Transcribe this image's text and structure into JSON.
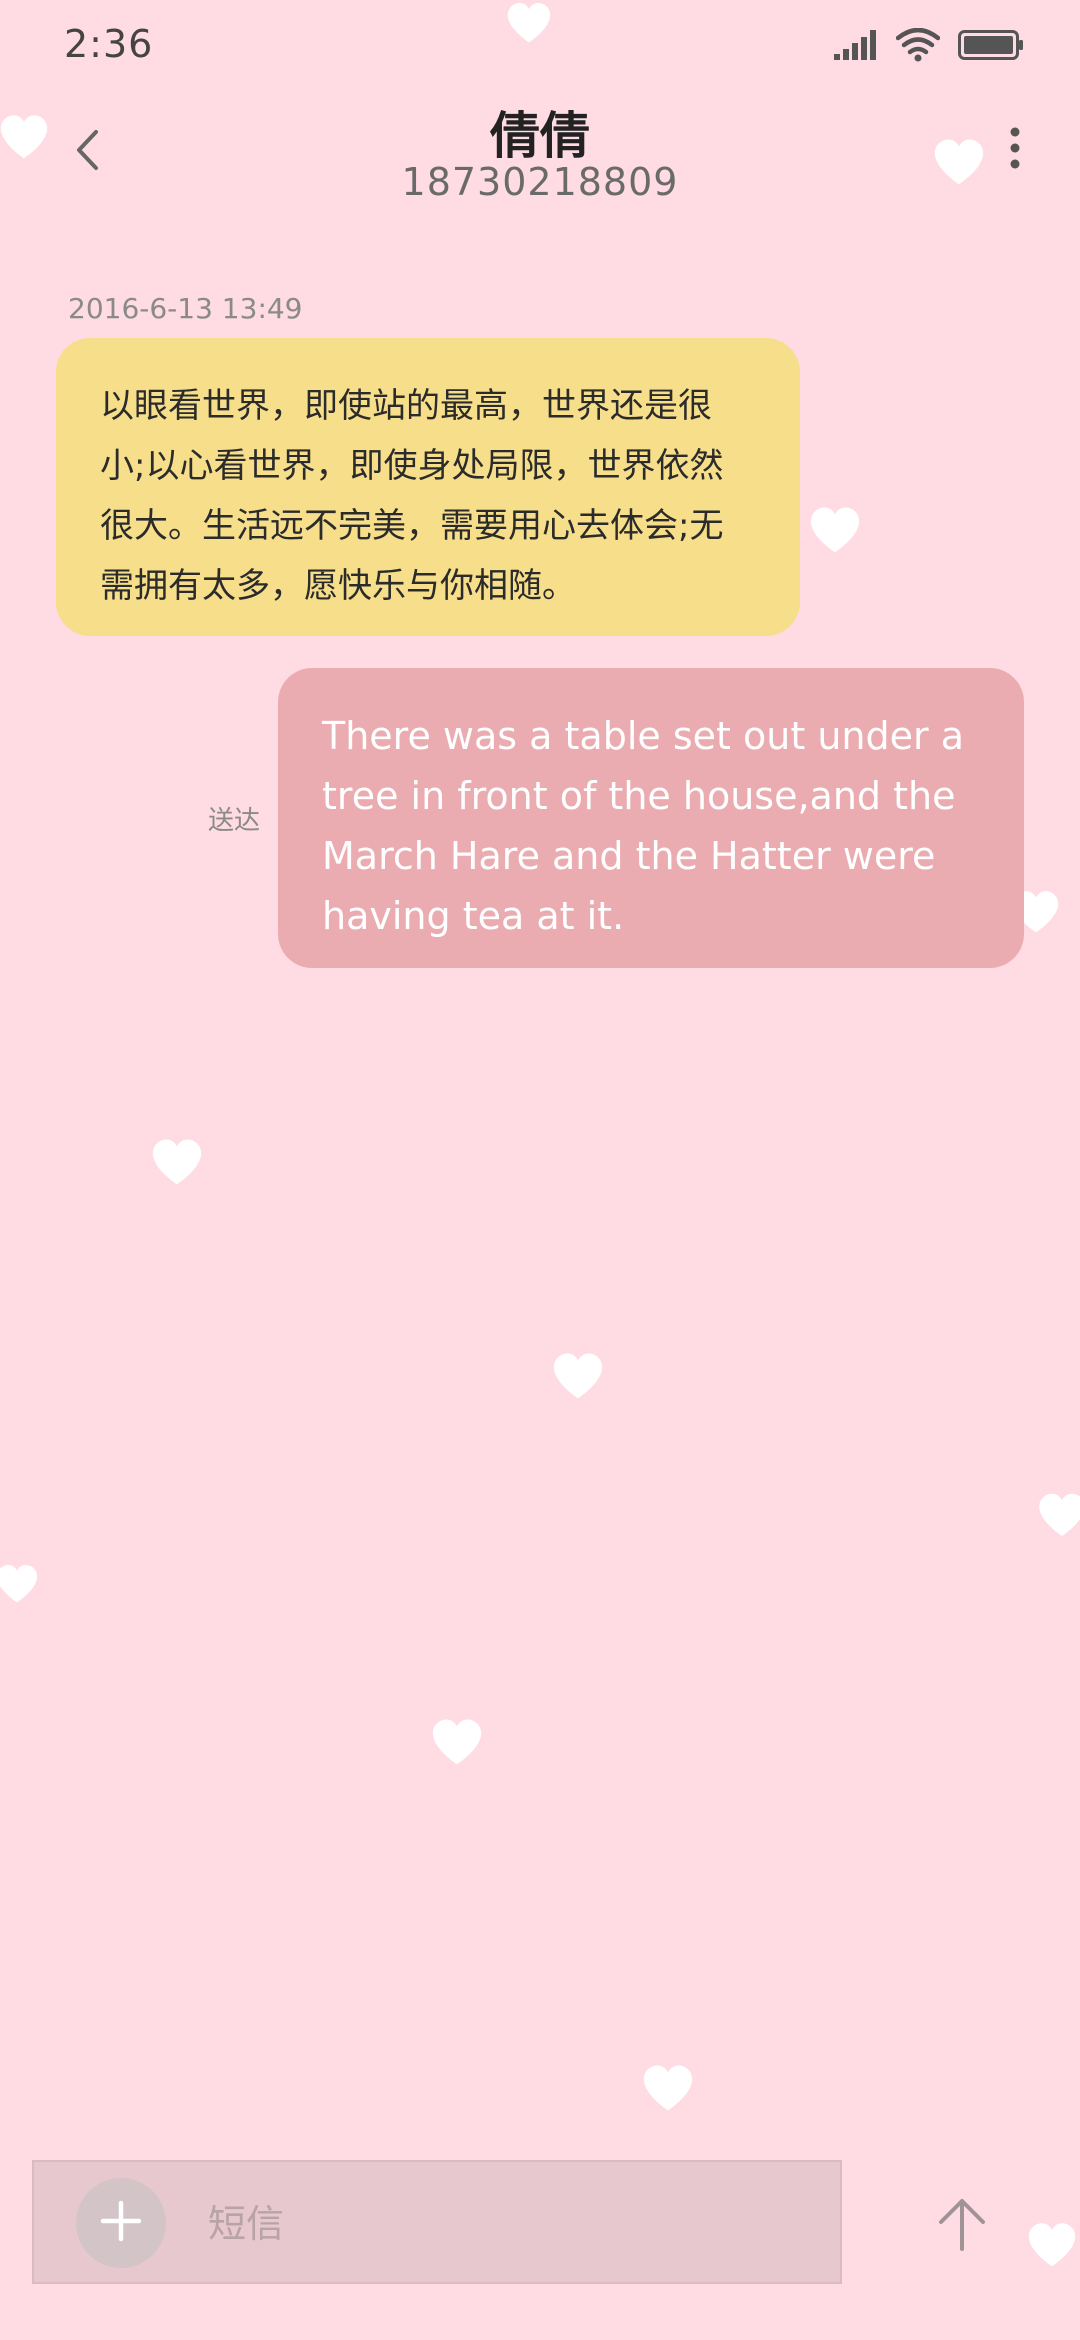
{
  "status_bar": {
    "time": "2:36"
  },
  "header": {
    "contact_name": "倩倩",
    "contact_number": "18730218809"
  },
  "messages": [
    {
      "direction": "incoming",
      "timestamp": "2016-6-13 13:49",
      "text": "以眼看世界，即使站的最高，世界还是很小;以心看世界，即使身处局限，世界依然很大。生活远不完美，需要用心去体会;无需拥有太多，愿快乐与你相随。"
    },
    {
      "direction": "outgoing",
      "status": "送达",
      "text": "There was a table set out under a tree in front of the house,and the March Hare and the Hatter were having tea at it."
    }
  ],
  "composer": {
    "placeholder": "短信"
  },
  "colors": {
    "background": "#ffdbe3",
    "incoming_bubble": "#f6de8a",
    "outgoing_bubble": "#eaacb0"
  },
  "icons": {
    "back": "chevron-left-icon",
    "more": "more-vertical-icon",
    "add": "plus-icon",
    "send": "arrow-up-icon",
    "signal": "signal-icon",
    "wifi": "wifi-icon",
    "battery": "battery-icon",
    "decoration": "heart-icon"
  }
}
